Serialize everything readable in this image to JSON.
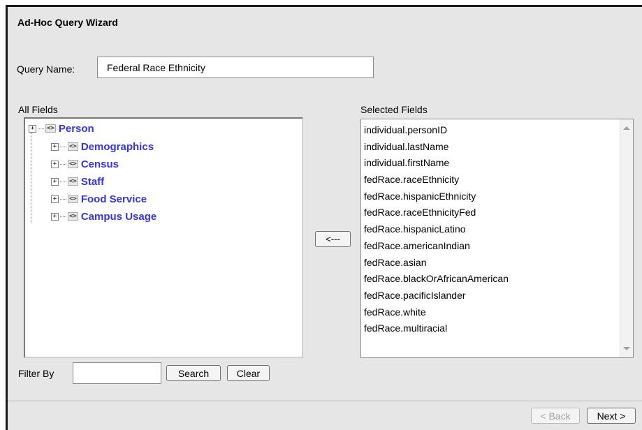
{
  "wizard": {
    "title": "Ad-Hoc Query Wizard",
    "query_name_label": "Query Name:",
    "query_name_value": "Federal Race Ethnicity"
  },
  "all_fields": {
    "label": "All Fields",
    "tree": {
      "root": "Person",
      "children": [
        "Demographics",
        "Census",
        "Staff",
        "Food Service",
        "Campus Usage"
      ]
    }
  },
  "move_button_label": "<---",
  "selected_fields": {
    "label": "Selected Fields",
    "items": [
      "individual.personID",
      "individual.lastName",
      "individual.firstName",
      "fedRace.raceEthnicity",
      "fedRace.hispanicEthnicity",
      "fedRace.raceEthnicityFed",
      "fedRace.hispanicLatino",
      "fedRace.americanIndian",
      "fedRace.asian",
      "fedRace.blackOrAfricanAmerican",
      "fedRace.pacificIslander",
      "fedRace.white",
      "fedRace.multiracial"
    ]
  },
  "filter": {
    "label": "Filter By",
    "value": "",
    "search_label": "Search",
    "clear_label": "Clear"
  },
  "nav": {
    "back_label": "< Back",
    "next_label": "Next >"
  }
}
